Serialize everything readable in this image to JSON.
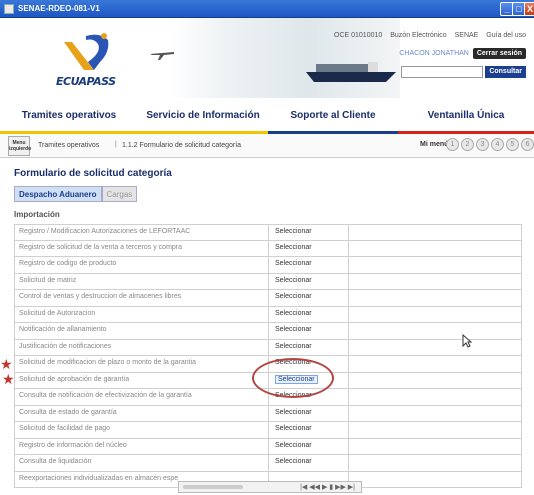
{
  "window": {
    "title": "SENAE-RDEO-081-V1",
    "min_label": "_",
    "max_label": "□",
    "close_label": "X"
  },
  "header": {
    "logo_text": "ECUAPASS",
    "links": [
      "OCE 01010010",
      "Buzón Electrónico",
      "SENAE",
      "Guía del uso"
    ],
    "user_name": "CHACON JONATHAN",
    "logout_label": "Cerrar sesión",
    "consult_label": "Consultar"
  },
  "menu": {
    "items": [
      {
        "label": "Tramites operativos",
        "stripe": "#f2c500"
      },
      {
        "label": "Servicio de Información",
        "stripe": "#f2c500"
      },
      {
        "label": "Soporte al Cliente",
        "stripe": "#1b3e8a"
      },
      {
        "label": "Ventanilla Única",
        "stripe": "#d2231f"
      }
    ]
  },
  "breadcrumb": {
    "menu_izq": "Menu izquierdo",
    "crumb1": "Tramites operativos",
    "separator": "|",
    "crumb2": "1.1.2 Formulario de solicitud categoría",
    "mi_menu": "Mi menú",
    "mi_nums": [
      "1",
      "2",
      "3",
      "4",
      "5",
      "6"
    ]
  },
  "page": {
    "title": "Formulario de solicitud categoría",
    "tabs": [
      {
        "label": "Despacho Aduanero",
        "active": true
      },
      {
        "label": "Cargas",
        "active": false
      }
    ],
    "section": "Importación"
  },
  "rows": [
    {
      "name": "Registro / Modificacion Autorizaciones de LEFORTAAC",
      "action": "Seleccionar"
    },
    {
      "name": "Registro de solicitud de la venta a terceros y compra",
      "action": "Seleccionar"
    },
    {
      "name": "Registro de codigo de producto",
      "action": "Seleccionar"
    },
    {
      "name": "Solicitud de matriz",
      "action": "Seleccionar"
    },
    {
      "name": "Control de ventas y destruccion de almacenes libres",
      "action": "Seleccionar"
    },
    {
      "name": "Solicitud de Autorizacion",
      "action": "Seleccionar"
    },
    {
      "name": "Notificación de allanamiento",
      "action": "Seleccionar"
    },
    {
      "name": "Justificación de notificaciones",
      "action": "Seleccionar"
    },
    {
      "name": "Solicitud de modificacion de plazo o monto de la garantia",
      "action": "Seleccionar"
    },
    {
      "name": "Solicitud de aprobación de garantía",
      "action": "Seleccionar",
      "highlight": true
    },
    {
      "name": "Consulta de notificación de efectivización de la garantía",
      "action": "Seleccionar"
    },
    {
      "name": "Consulta de estado de garantía",
      "action": "Seleccionar"
    },
    {
      "name": "Solicitud de facilidad de pago",
      "action": "Seleccionar"
    },
    {
      "name": "Registro de información del núcleo",
      "action": "Seleccionar"
    },
    {
      "name": "Consulta de liquidación",
      "action": "Seleccionar"
    },
    {
      "name": "Reexportaciones individualizadas en almacén espe",
      "action": ""
    }
  ],
  "pager": {
    "controls": "|◀ ◀◀ ▶ ▮ ▶▶ ▶|"
  },
  "colors": {
    "accent_blue": "#1b3e8a",
    "menu_yellow": "#f2c500",
    "menu_red": "#d2231f",
    "annotation_red": "#b2453f"
  }
}
